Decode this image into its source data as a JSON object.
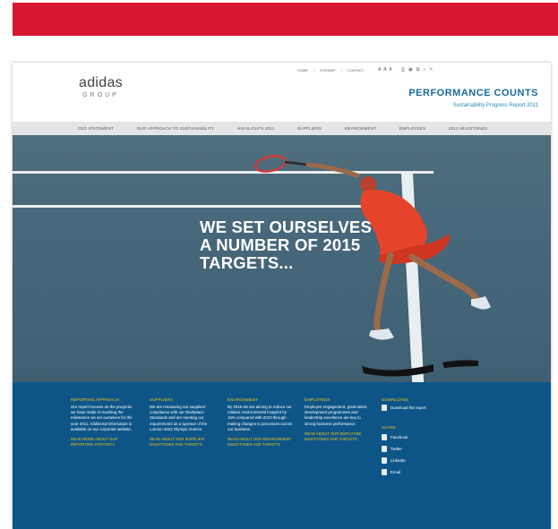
{
  "header": {
    "logo_main": "adidas",
    "logo_sub": "GROUP",
    "top_links": [
      "HOME",
      "SITEMAP",
      "CONTACT"
    ],
    "text_size": "A A A",
    "title": "PERFORMANCE COUNTS",
    "subtitle": "Sustainability Progress Report 2011"
  },
  "nav": {
    "items": [
      "CEO STATEMENT",
      "OUR APPROACH TO SUSTAINABILITY",
      "HIGHLIGHTS 2011",
      "SUPPLIERS",
      "ENVIRONMENT",
      "EMPLOYEES",
      "2012 MILESTONES"
    ]
  },
  "hero": {
    "headline": "WE SET OURSELVES\nA NUMBER OF 2015\nTARGETS..."
  },
  "footer": {
    "columns": [
      {
        "heading": "REPORTING APPROACH",
        "text": "Our report focuses on the progress we have made in reaching the milestones we set ourselves for the year 2011. Additional information is available on our corporate website.",
        "link": "READ MORE ABOUT OUR REPORTING STRATEGY"
      },
      {
        "heading": "SUPPLIERS",
        "text": "We are measuring our suppliers' compliance with our Workplace Standards and are meeting our requirements as a sponsor of the London 2012 Olympic Games.",
        "link": "READ ABOUT OUR SUPPLIER MILESTONES AND TARGETS"
      },
      {
        "heading": "ENVIRONMENT",
        "text": "By 2015 we are aiming to reduce our relative environmental footprint by 15% compared with 2010 through making changes to processes across our business.",
        "link": "READ ABOUT OUR ENVIRONMENT MILESTONES AND TARGETS"
      },
      {
        "heading": "EMPLOYEES",
        "text": "Employee engagement, great talent development programmes and leadership excellence are key to strong business performance.",
        "link": "READ ABOUT OUR EMPLOYEE MILESTONES AND TARGETS"
      }
    ],
    "downloads": {
      "heading": "DOWNLOADS",
      "item": "Download the report"
    },
    "share": {
      "heading": "SHARE",
      "items": [
        "Facebook",
        "Twitter",
        "LinkedIn",
        "Email"
      ]
    }
  },
  "colors": {
    "brand_red": "#d7172f",
    "footer_blue": "#0e5587",
    "accent_yellow": "#e6c21a",
    "title_blue": "#1a6a9a"
  }
}
